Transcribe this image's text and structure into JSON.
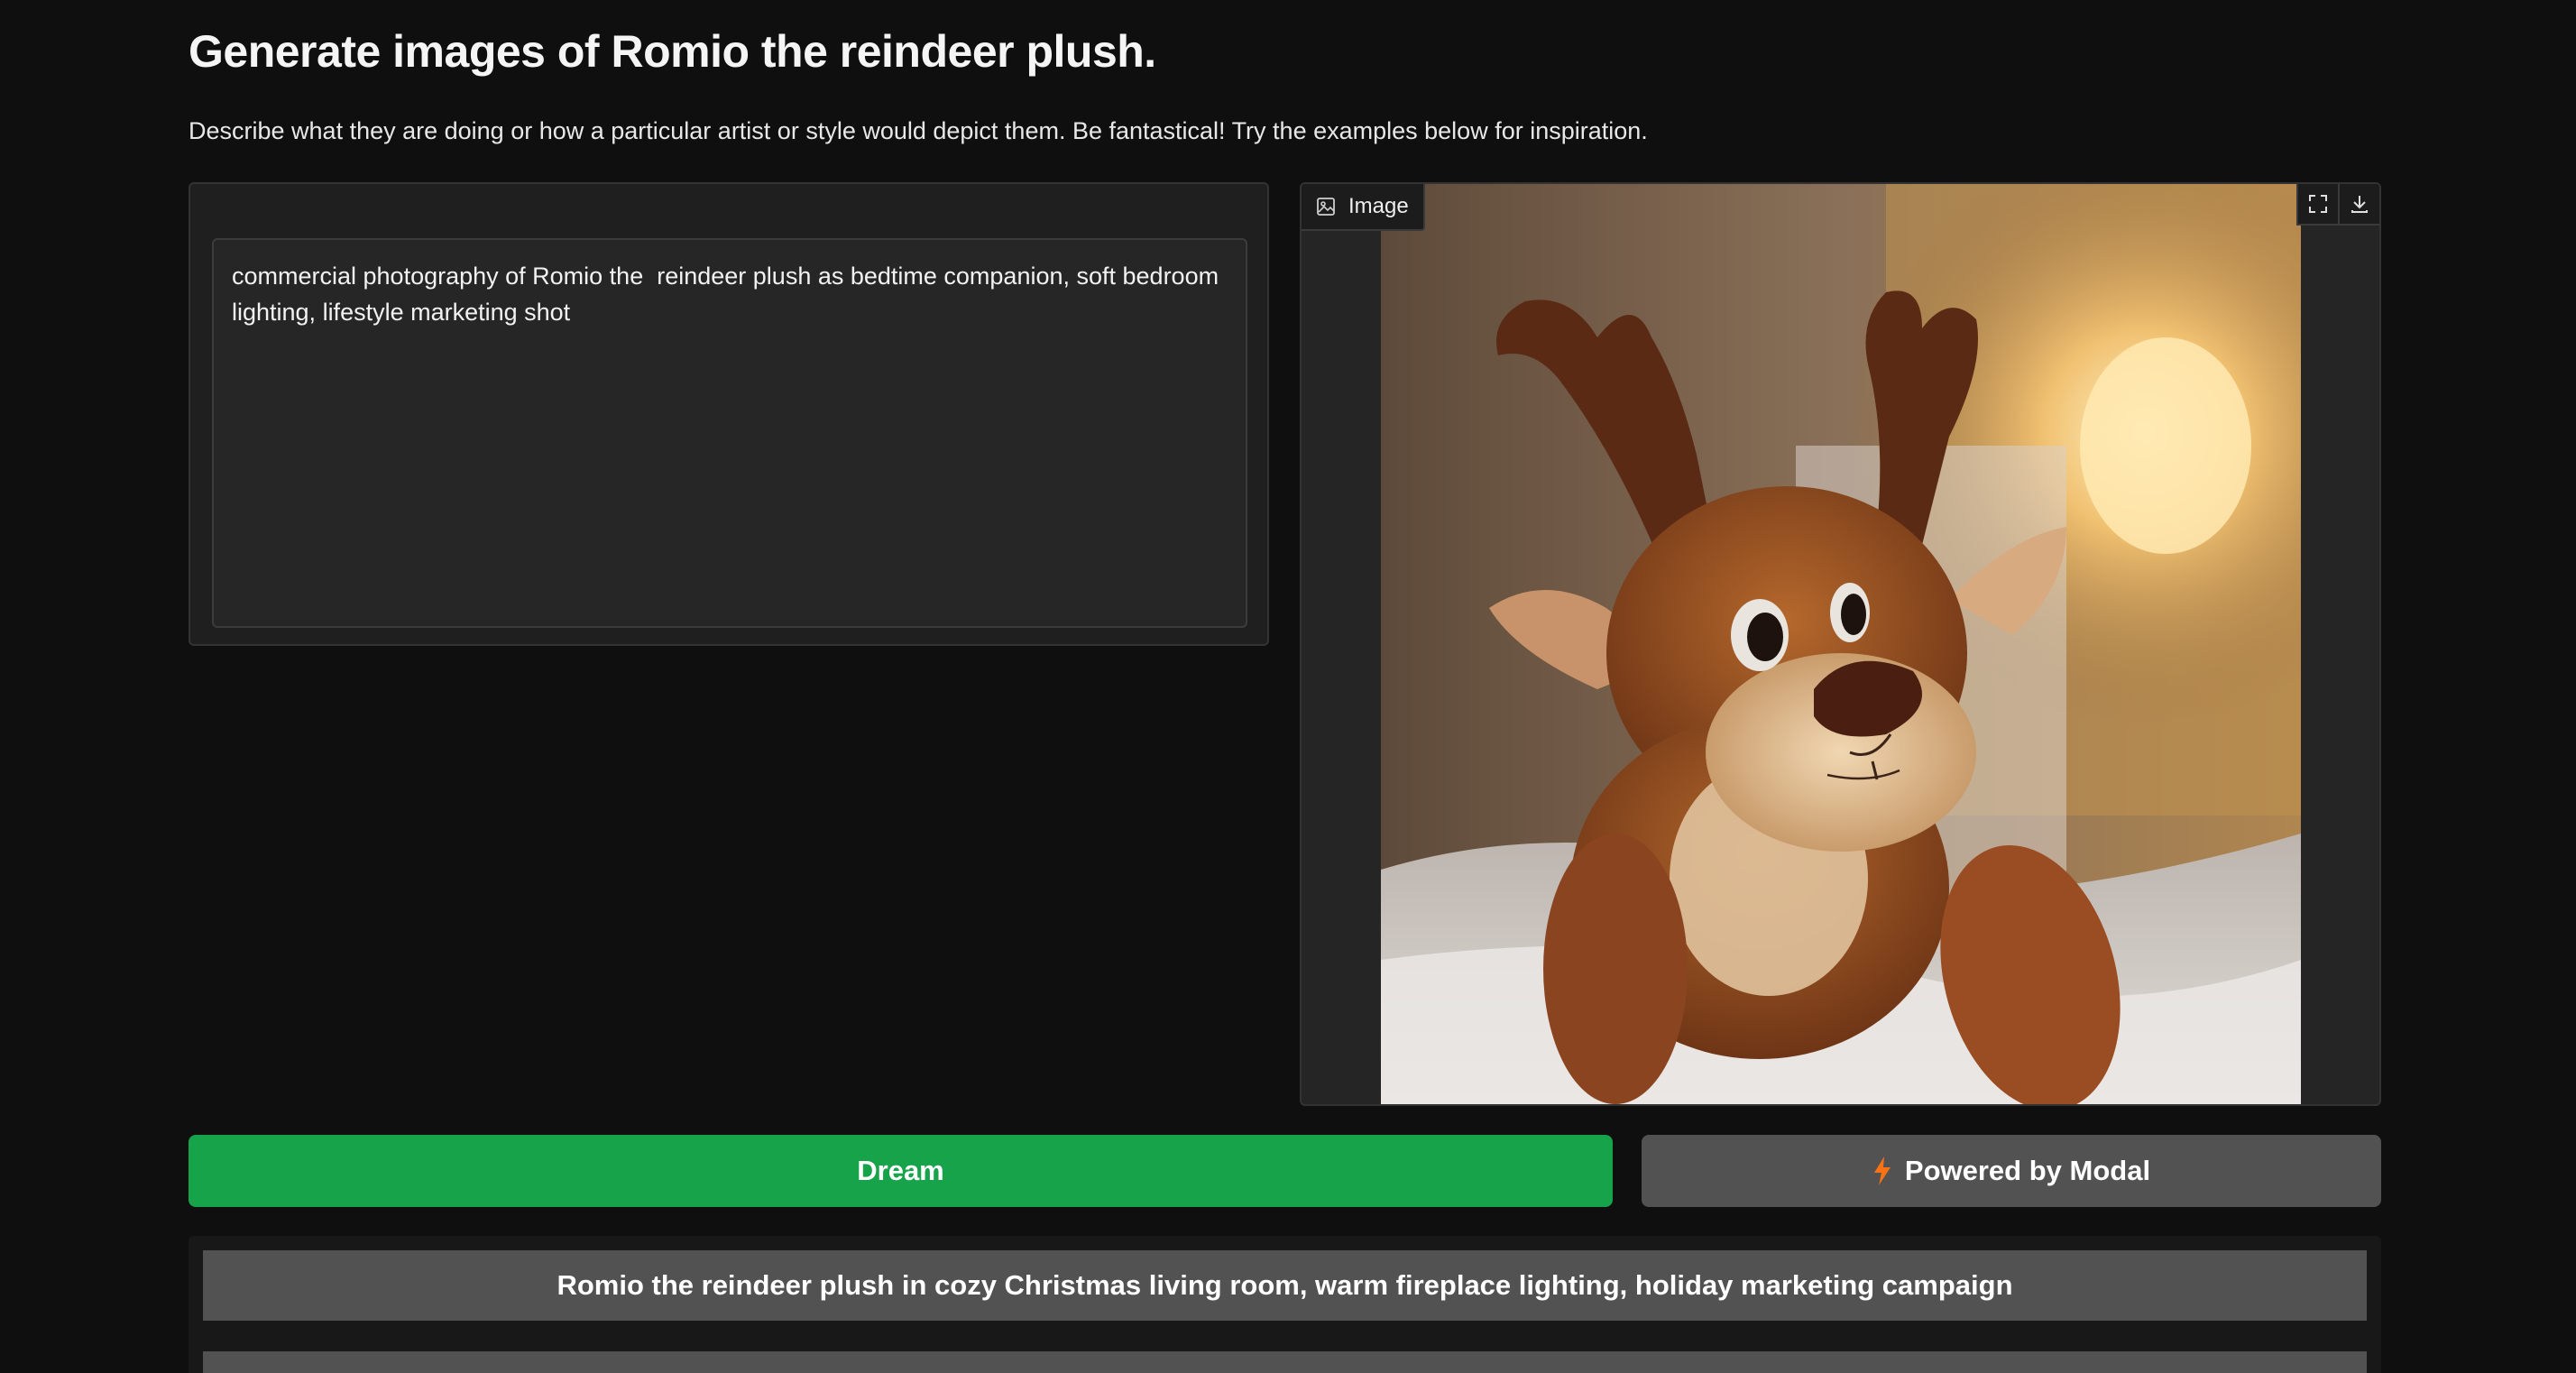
{
  "header": {
    "title": "Generate images of Romio the reindeer plush.",
    "subtitle": "Describe what they are doing or how a particular artist or style would depict them. Be fantastical! Try the examples below for inspiration."
  },
  "prompt": {
    "value": "commercial photography of Romio the  reindeer plush as bedtime companion, soft bedroom lighting, lifestyle marketing shot"
  },
  "output": {
    "label": "Image",
    "label_icon": "image-icon",
    "tools": [
      "fullscreen-icon",
      "download-icon"
    ]
  },
  "actions": {
    "dream_label": "Dream",
    "modal_label": "Powered by Modal",
    "modal_icon": "bolt-icon",
    "colors": {
      "dream": "#16a34a",
      "secondary": "#525252",
      "bolt": "#f97316"
    }
  },
  "examples": [
    "Romio the reindeer plush in cozy Christmas living room, warm fireplace lighting, holiday marketing campaign",
    ""
  ]
}
